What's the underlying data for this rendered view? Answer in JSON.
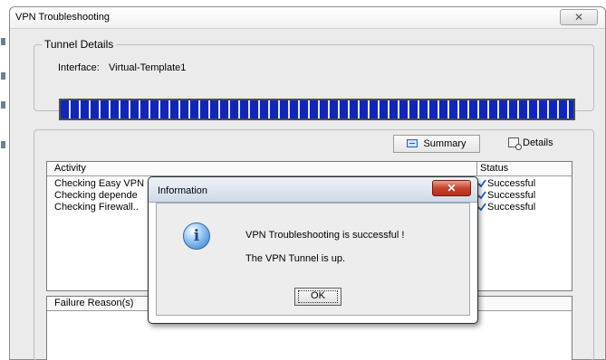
{
  "window": {
    "title": "VPN Troubleshooting",
    "close_icon": "close-icon"
  },
  "tunnel_details": {
    "legend": "Tunnel Details",
    "interface_label": "Interface:",
    "interface_value": "Virtual-Template1"
  },
  "progress": {
    "fraction": 1.0,
    "color": "#1126b4"
  },
  "toolbar": {
    "summary_label": "Summary",
    "summary_icon": "summary-icon",
    "details_label": "Details",
    "details_icon": "details-icon"
  },
  "activity_table": {
    "columns": [
      "Activity",
      "Status"
    ],
    "rows": [
      {
        "activity": "Checking Easy VPN",
        "status": "Successful"
      },
      {
        "activity": "Checking depende",
        "status": "Successful"
      },
      {
        "activity": "Checking Firewall..",
        "status": "Successful"
      }
    ]
  },
  "failure_table": {
    "header": "Failure Reason(s)"
  },
  "dialog": {
    "title": "Information",
    "close_icon": "close-icon",
    "icon": "info-icon",
    "message": "VPN Troubleshooting is successful !",
    "detail": "The VPN Tunnel is up.",
    "ok_label": "OK"
  },
  "colors": {
    "progress_fill": "#1126b4",
    "dialog_close": "#c7432b",
    "check_mark": "#1f5fbf"
  }
}
